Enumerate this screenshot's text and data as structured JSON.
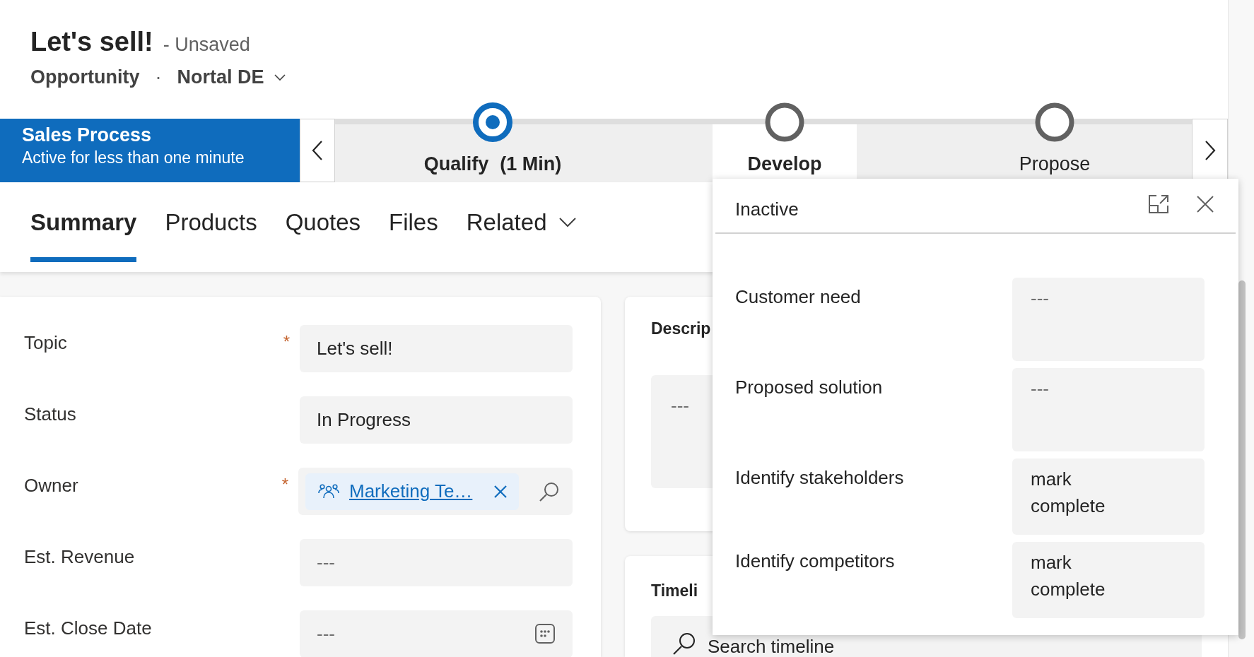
{
  "header": {
    "title": "Let's sell!",
    "save_status": "- Unsaved",
    "entity": "Opportunity",
    "separator": "·",
    "owner": "Nortal DE"
  },
  "process": {
    "name": "Sales Process",
    "duration": "Active for less than one minute",
    "stages": [
      {
        "label": "Qualify",
        "time": "(1 Min)",
        "active": true,
        "selected": false
      },
      {
        "label": "Develop",
        "active": false,
        "selected": true
      },
      {
        "label": "Propose",
        "active": false,
        "selected": false
      }
    ]
  },
  "tabs": [
    {
      "label": "Summary",
      "selected": true
    },
    {
      "label": "Products",
      "selected": false
    },
    {
      "label": "Quotes",
      "selected": false
    },
    {
      "label": "Files",
      "selected": false
    },
    {
      "label": "Related",
      "selected": false,
      "dropdown": true
    }
  ],
  "form": {
    "required_mark": "*",
    "fields": [
      {
        "label": "Topic",
        "required": true,
        "kind": "text",
        "value": "Let's sell!"
      },
      {
        "label": "Status",
        "required": false,
        "kind": "text",
        "value": "In Progress"
      },
      {
        "label": "Owner",
        "required": true,
        "kind": "lookup",
        "value": "Marketing Te…"
      },
      {
        "label": "Est. Revenue",
        "required": false,
        "kind": "text",
        "placeholder": "---"
      },
      {
        "label": "Est. Close Date",
        "required": false,
        "kind": "date",
        "placeholder": "---"
      }
    ]
  },
  "description": {
    "title": "Descrip",
    "placeholder": "---"
  },
  "timeline": {
    "title": "Timeli",
    "placeholder": "Search timeline"
  },
  "flyout": {
    "title": "Inactive",
    "steps": [
      {
        "label": "Customer need",
        "placeholder": "---"
      },
      {
        "label": "Proposed solution",
        "placeholder": "---"
      },
      {
        "label": "Identify stakeholders",
        "value": "mark complete"
      },
      {
        "label": "Identify competitors",
        "value": "mark complete"
      }
    ]
  }
}
